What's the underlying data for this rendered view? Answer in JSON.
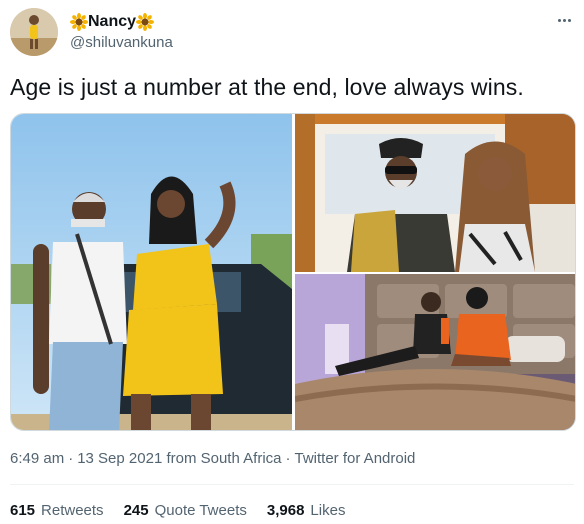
{
  "user": {
    "display_name": "Nancy",
    "name_emoji_icon": "sunflower-icon",
    "handle": "@shiluvankuna"
  },
  "tweet": {
    "text": "Age is just a number at the end, love always wins."
  },
  "media": {
    "photo_count": 3
  },
  "meta": {
    "time": "6:49 am",
    "sep1": "·",
    "date_location": "13 Sep 2021 from South Africa",
    "sep2": "·",
    "source": "Twitter for Android"
  },
  "stats": {
    "retweets_count": "615",
    "retweets_label": "Retweets",
    "quotes_count": "245",
    "quotes_label": "Quote Tweets",
    "likes_count": "3,968",
    "likes_label": "Likes"
  },
  "colors": {
    "text_primary": "#0f1419",
    "text_secondary": "#536471",
    "divider": "#eff3f4"
  }
}
